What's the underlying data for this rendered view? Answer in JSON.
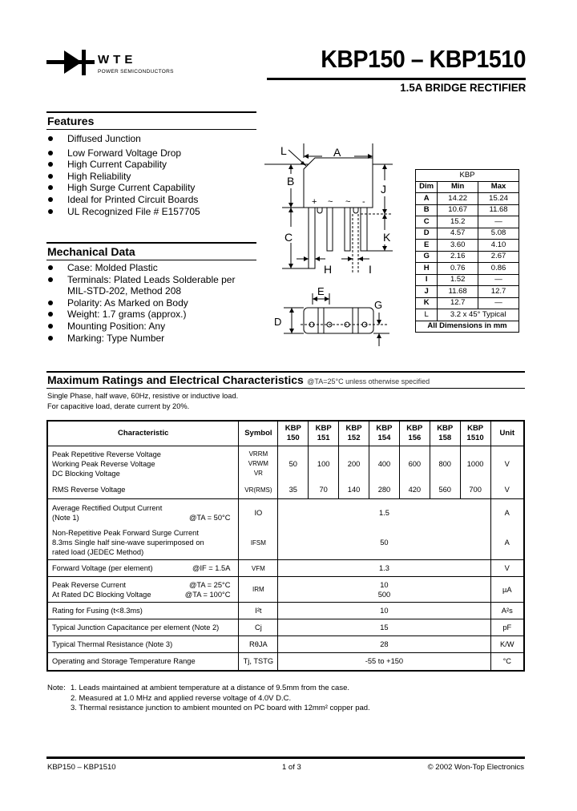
{
  "header": {
    "brand": "WTE",
    "brand_tagline": "POWER SEMICONDUCTORS",
    "title": "KBP150 – KBP1510",
    "subtitle": "1.5A BRIDGE RECTIFIER"
  },
  "features": {
    "title": "Features",
    "items": [
      "Diffused Junction",
      "Low Forward Voltage Drop",
      "High Current Capability",
      "High Reliability",
      "High Surge Current Capability",
      "Ideal for Printed Circuit Boards",
      "UL Recognized File # E157705"
    ]
  },
  "mechanical": {
    "title": "Mechanical Data",
    "items": [
      "Case: Molded Plastic",
      "Terminals: Plated Leads Solderable per",
      "MIL-STD-202, Method 208",
      "Polarity: As Marked on Body",
      "Weight: 1.7 grams (approx.)",
      "Mounting Position: Any",
      "Marking: Type Number"
    ]
  },
  "diagram": {
    "labels": {
      "A": "A",
      "B": "B",
      "C": "C",
      "D": "D",
      "E": "E",
      "G": "G",
      "H": "H",
      "I": "I",
      "J": "J",
      "K": "K",
      "L": "L"
    },
    "pin_marks": [
      "+",
      "~",
      "~",
      "-"
    ]
  },
  "dimensions": {
    "package": "KBP",
    "headers": [
      "Dim",
      "Min",
      "Max"
    ],
    "rows": [
      {
        "dim": "A",
        "min": "14.22",
        "max": "15.24"
      },
      {
        "dim": "B",
        "min": "10.67",
        "max": "11.68"
      },
      {
        "dim": "C",
        "min": "15.2",
        "max": "—"
      },
      {
        "dim": "D",
        "min": "4.57",
        "max": "5.08"
      },
      {
        "dim": "E",
        "min": "3.60",
        "max": "4.10"
      },
      {
        "dim": "G",
        "min": "2.16",
        "max": "2.67"
      },
      {
        "dim": "H",
        "min": "0.76",
        "max": "0.86"
      },
      {
        "dim": "I",
        "min": "1.52",
        "max": "—"
      },
      {
        "dim": "J",
        "min": "11.68",
        "max": "12.7"
      },
      {
        "dim": "K",
        "min": "12.7",
        "max": "—"
      }
    ],
    "row_L": {
      "dim": "L",
      "value": "3.2 x 45° Typical"
    },
    "footer": "All Dimensions in mm"
  },
  "ratings": {
    "title": "Maximum Ratings and Electrical Characteristics",
    "title_cond": "@TA=25°C unless otherwise specified",
    "intro": [
      "Single Phase, half wave, 60Hz, resistive or inductive load.",
      "For capacitive load, derate current by 20%."
    ],
    "headers": {
      "characteristic": "Characteristic",
      "symbol": "Symbol",
      "parts": [
        [
          "KBP",
          "150"
        ],
        [
          "KBP",
          "151"
        ],
        [
          "KBP",
          "152"
        ],
        [
          "KBP",
          "154"
        ],
        [
          "KBP",
          "156"
        ],
        [
          "KBP",
          "158"
        ],
        [
          "KBP",
          "1510"
        ]
      ],
      "unit": "Unit"
    },
    "voltage_rows": {
      "peak": {
        "lines": [
          "Peak Repetitive Reverse Voltage",
          "Working Peak Reverse Voltage",
          "DC Blocking Voltage"
        ],
        "symbols": [
          "VRRM",
          "VRWM",
          "VR"
        ],
        "values": [
          "50",
          "100",
          "200",
          "400",
          "600",
          "800",
          "1000"
        ],
        "unit": "V"
      },
      "rms": {
        "label": "RMS Reverse Voltage",
        "symbol": "VR(RMS)",
        "values": [
          "35",
          "70",
          "140",
          "280",
          "420",
          "560",
          "700"
        ],
        "unit": "V"
      }
    },
    "rows": [
      {
        "lines": [
          "Average Rectified Output Current",
          "(Note 1)"
        ],
        "cond": "@TA = 50°C",
        "symbol": "IO",
        "value": "1.5",
        "unit": "A"
      },
      {
        "lines": [
          "Non-Repetitive Peak Forward Surge Current",
          "8.3ms Single half sine-wave superimposed on",
          "rated load (JEDEC Method)"
        ],
        "cond": "",
        "symbol": "IFSM",
        "value": "50",
        "unit": "A"
      },
      {
        "lines": [
          "Forward Voltage (per element)"
        ],
        "cond": "@IF = 1.5A",
        "symbol": "VFM",
        "value": "1.3",
        "unit": "V"
      },
      {
        "lines": [
          "Peak Reverse Current",
          "At Rated DC Blocking Voltage"
        ],
        "conds": [
          "@TA = 25°C",
          "@TA = 100°C"
        ],
        "symbol": "IRM",
        "values": [
          "10",
          "500"
        ],
        "unit": "µA"
      },
      {
        "lines": [
          "Rating for Fusing (t<8.3ms)"
        ],
        "cond": "",
        "symbol": "I²t",
        "value": "10",
        "unit": "A²s"
      },
      {
        "lines": [
          "Typical Junction Capacitance per element (Note 2)"
        ],
        "cond": "",
        "symbol": "Cj",
        "value": "15",
        "unit": "pF"
      },
      {
        "lines": [
          "Typical Thermal Resistance (Note 3)"
        ],
        "cond": "",
        "symbol": "RθJA",
        "value": "28",
        "unit": "K/W"
      },
      {
        "lines": [
          "Operating and Storage Temperature Range"
        ],
        "cond": "",
        "symbol": "Tj, TSTG",
        "value": "-55 to +150",
        "unit": "°C"
      }
    ]
  },
  "notes": {
    "label": "Note:",
    "items": [
      "1. Leads maintained at ambient temperature at a distance of 9.5mm from the case.",
      "2. Measured at 1.0 MHz and applied reverse voltage of 4.0V D.C.",
      "3. Thermal resistance junction to ambient mounted on PC board with 12mm² copper pad."
    ]
  },
  "footer": {
    "left": "KBP150 – KBP1510",
    "center": "1 of 3",
    "right": "© 2002 Won-Top Electronics"
  }
}
